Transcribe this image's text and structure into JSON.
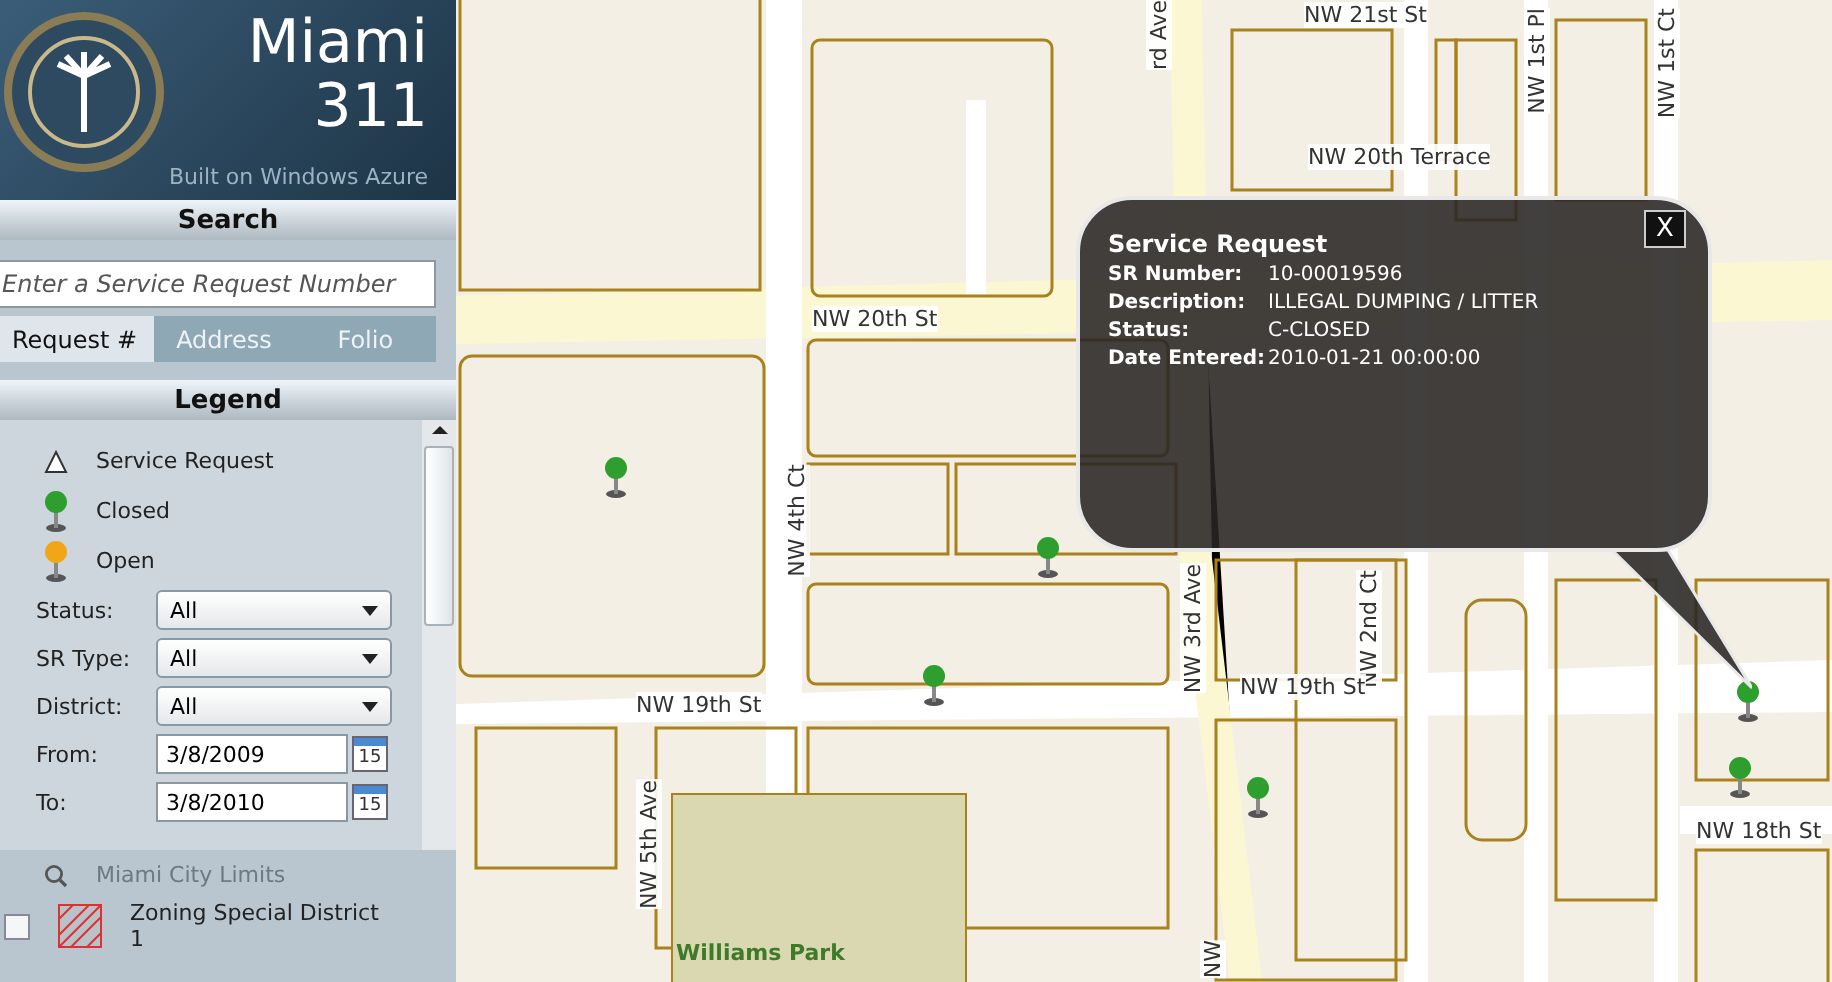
{
  "header": {
    "title_line1": "Miami",
    "title_line2": "311",
    "subtitle": "Built on Windows Azure"
  },
  "search": {
    "heading": "Search",
    "placeholder": "Enter a Service Request Number",
    "tabs": [
      {
        "label": "Request #",
        "selected": true
      },
      {
        "label": "Address",
        "selected": false
      },
      {
        "label": "Folio",
        "selected": false
      }
    ]
  },
  "legend": {
    "heading": "Legend",
    "items": [
      {
        "label": "Service Request",
        "kind": "triangle"
      },
      {
        "label": "Closed",
        "kind": "pin",
        "color": "#2e9e2e"
      },
      {
        "label": "Open",
        "kind": "pin",
        "color": "#f2a516"
      }
    ],
    "filters": [
      {
        "label": "Status:",
        "value": "All",
        "kind": "select"
      },
      {
        "label": "SR Type:",
        "value": "All",
        "kind": "select"
      },
      {
        "label": "District:",
        "value": "All",
        "kind": "select"
      },
      {
        "label": "From:",
        "value": "3/8/2009",
        "kind": "date",
        "calendar": "15"
      },
      {
        "label": "To:",
        "value": "3/8/2010",
        "kind": "date",
        "calendar": "15"
      }
    ],
    "layers": [
      {
        "label": "Miami City Limits",
        "kind": "search"
      },
      {
        "label": "Zoning Special District 1",
        "kind": "zoning",
        "checked": false
      }
    ]
  },
  "map": {
    "streets": [
      "NW 21st St",
      "rd Ave",
      "NW 20th Terrace",
      "NW 20th St",
      "NW 4th Ct",
      "NW 3rd Ave",
      "NW 2nd Ct",
      "NW 1st Pl",
      "NW 1st Ct",
      "NW 19th St",
      "NW 19th St",
      "NW 18th St",
      "NW 5th Ave",
      "NW"
    ],
    "park": "Williams Park"
  },
  "popup": {
    "title": "Service Request",
    "close": "X",
    "fields": [
      {
        "label": "SR Number:",
        "value": "10-00019596"
      },
      {
        "label": "Description:",
        "value": "ILLEGAL DUMPING / LITTER"
      },
      {
        "label": "Status:",
        "value": "C-CLOSED"
      },
      {
        "label": "Date Entered:",
        "value": "2010-01-21 00:00:00"
      }
    ]
  }
}
